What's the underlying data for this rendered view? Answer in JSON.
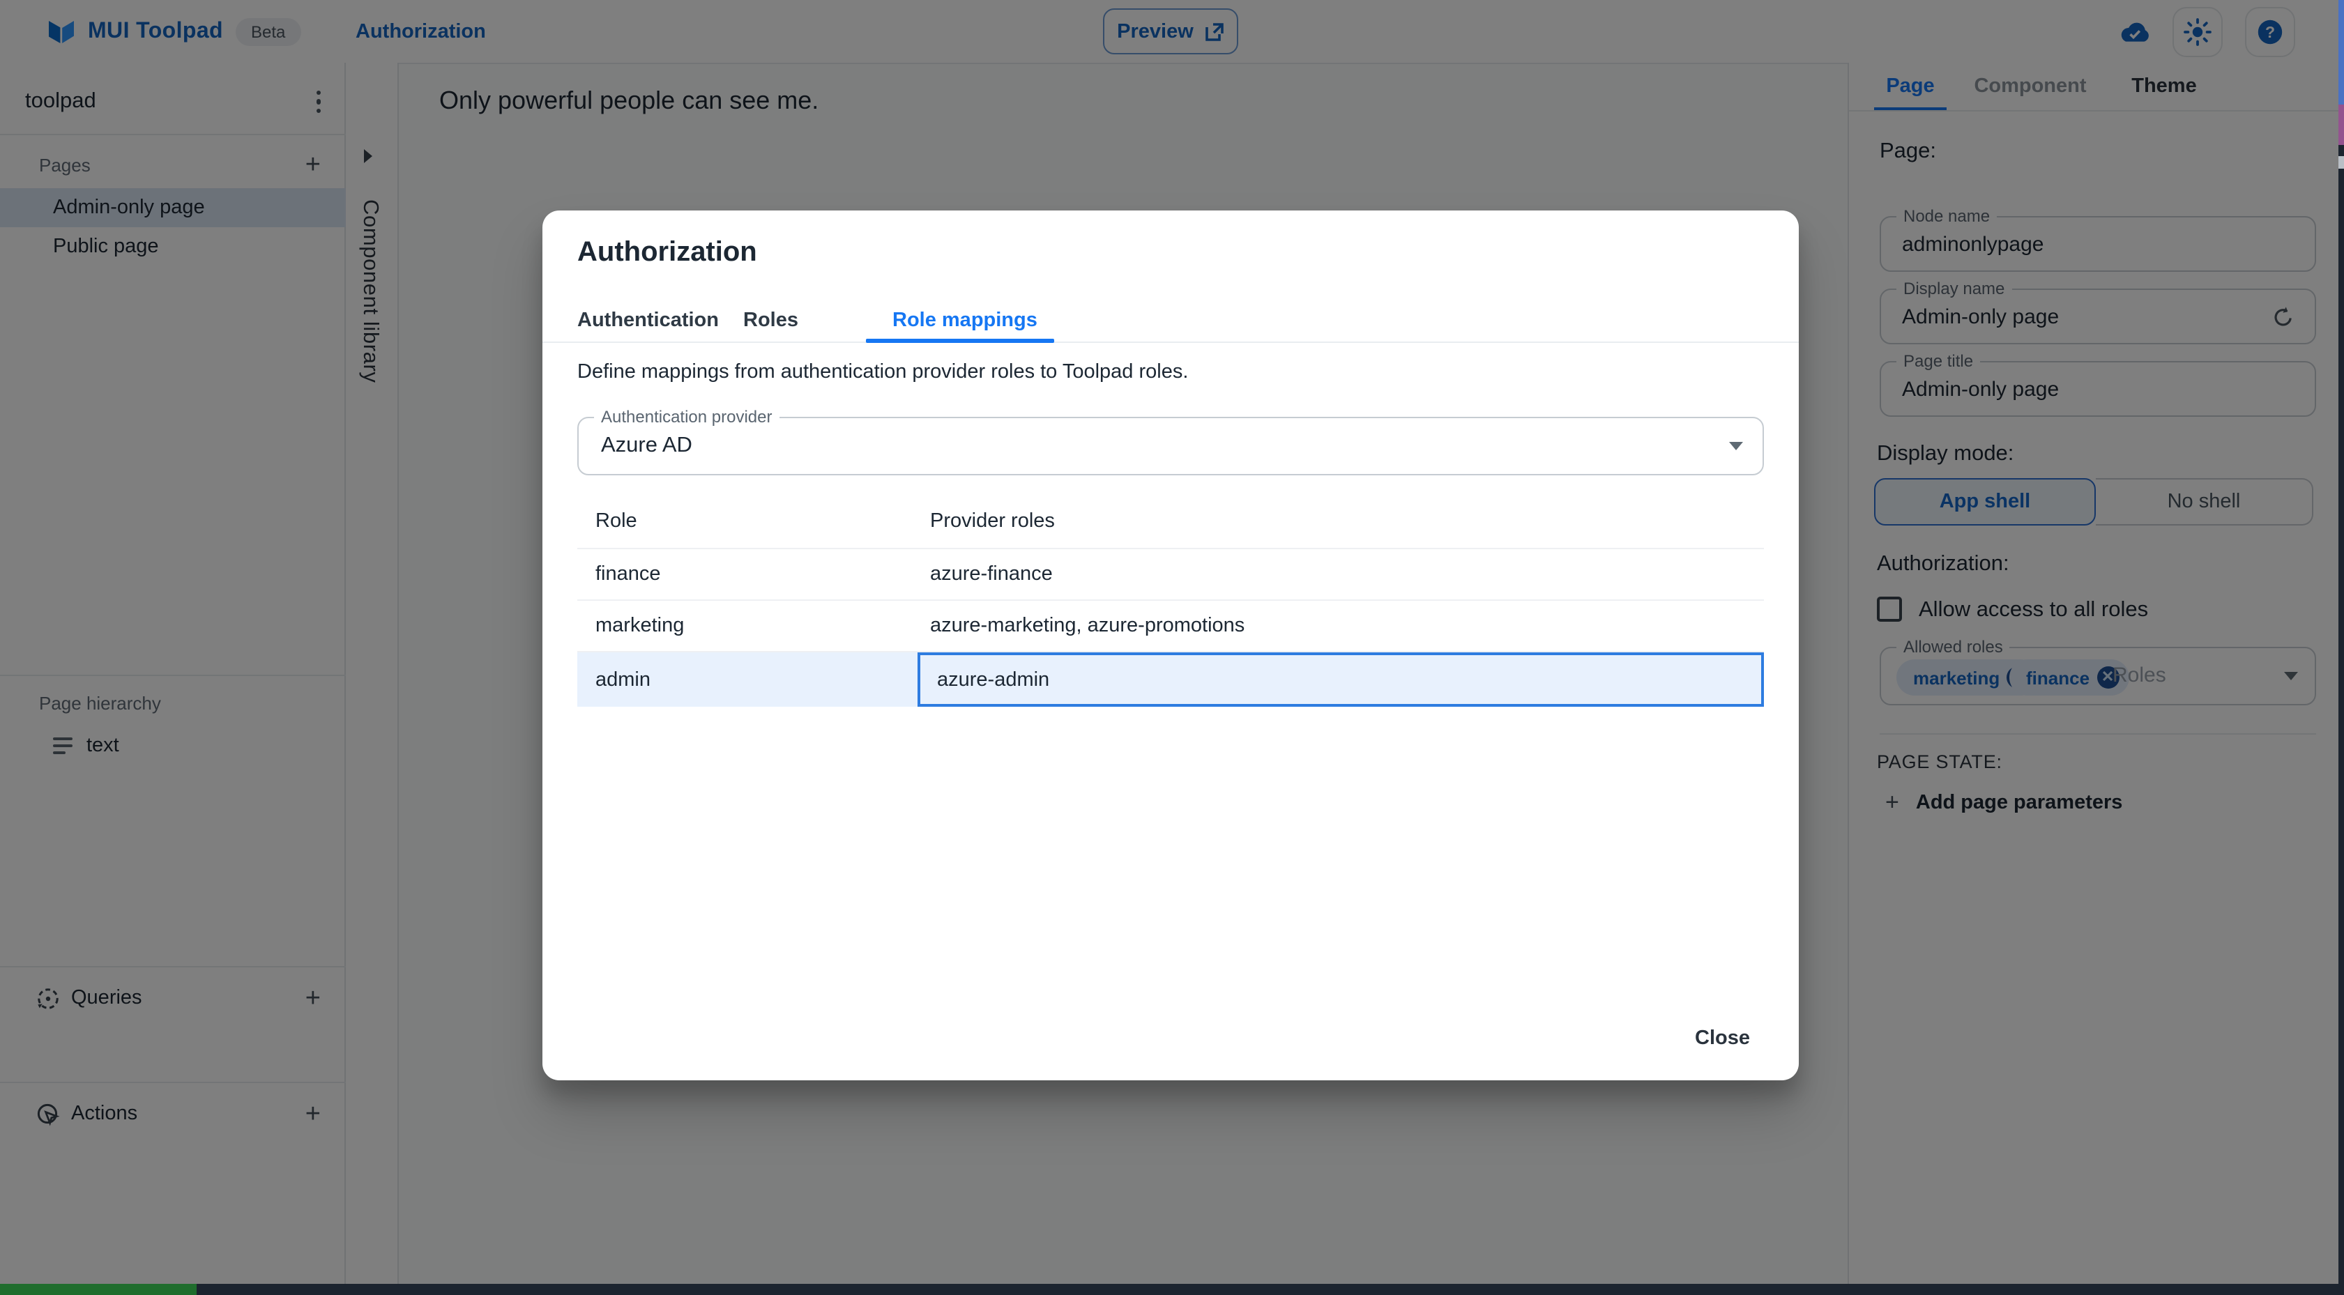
{
  "header": {
    "app_name": "MUI Toolpad",
    "beta_badge": "Beta",
    "nav_link": "Authorization",
    "preview_button": "Preview"
  },
  "sidebar": {
    "project_name": "toolpad",
    "pages_label": "Pages",
    "pages": [
      {
        "label": "Admin-only page",
        "selected": true
      },
      {
        "label": "Public page",
        "selected": false
      }
    ],
    "hierarchy_label": "Page hierarchy",
    "hierarchy_item": "text",
    "queries_label": "Queries",
    "actions_label": "Actions"
  },
  "component_library": {
    "label": "Component library"
  },
  "canvas": {
    "text": "Only powerful people can see me."
  },
  "dialog": {
    "title": "Authorization",
    "tabs": [
      {
        "label": "Authentication",
        "active": false
      },
      {
        "label": "Roles",
        "active": false
      },
      {
        "label": "Role mappings",
        "active": true
      }
    ],
    "description": "Define mappings from authentication provider roles to Toolpad roles.",
    "provider_select": {
      "label": "Authentication provider",
      "value": "Azure AD"
    },
    "table": {
      "columns": [
        "Role",
        "Provider roles"
      ],
      "rows": [
        {
          "role": "finance",
          "provider_roles": "azure-finance",
          "selected": false
        },
        {
          "role": "marketing",
          "provider_roles": "azure-marketing, azure-promotions",
          "selected": false
        },
        {
          "role": "admin",
          "provider_roles": "azure-admin",
          "selected": true
        }
      ]
    },
    "close_button": "Close"
  },
  "inspector": {
    "tabs": [
      {
        "label": "Page",
        "active": true
      },
      {
        "label": "Component",
        "muted": true
      },
      {
        "label": "Theme",
        "active": false
      }
    ],
    "heading": "Page:",
    "node_name": {
      "label": "Node name",
      "value": "adminonlypage"
    },
    "display_name": {
      "label": "Display name",
      "value": "Admin-only page"
    },
    "page_title": {
      "label": "Page title",
      "value": "Admin-only page"
    },
    "display_mode": {
      "label": "Display mode:",
      "options": [
        {
          "label": "App shell",
          "selected": true
        },
        {
          "label": "No shell",
          "selected": false
        }
      ]
    },
    "authorization": {
      "label": "Authorization:",
      "allow_all_label": "Allow access to all roles",
      "allow_all_checked": false,
      "allowed_roles": {
        "label": "Allowed roles",
        "chips": [
          "marketing",
          "finance"
        ],
        "placeholder": "Roles"
      }
    },
    "page_state": {
      "label": "PAGE STATE:",
      "add_button": "Add page parameters"
    }
  },
  "colors": {
    "primary_tab_blue": "#1677f3",
    "brand_blue": "#1565c0",
    "selected_row_bg": "#e8f1fd",
    "focused_cell_border": "#2e7ce0",
    "sidebar_selected_bg": "#d9e4f2"
  }
}
